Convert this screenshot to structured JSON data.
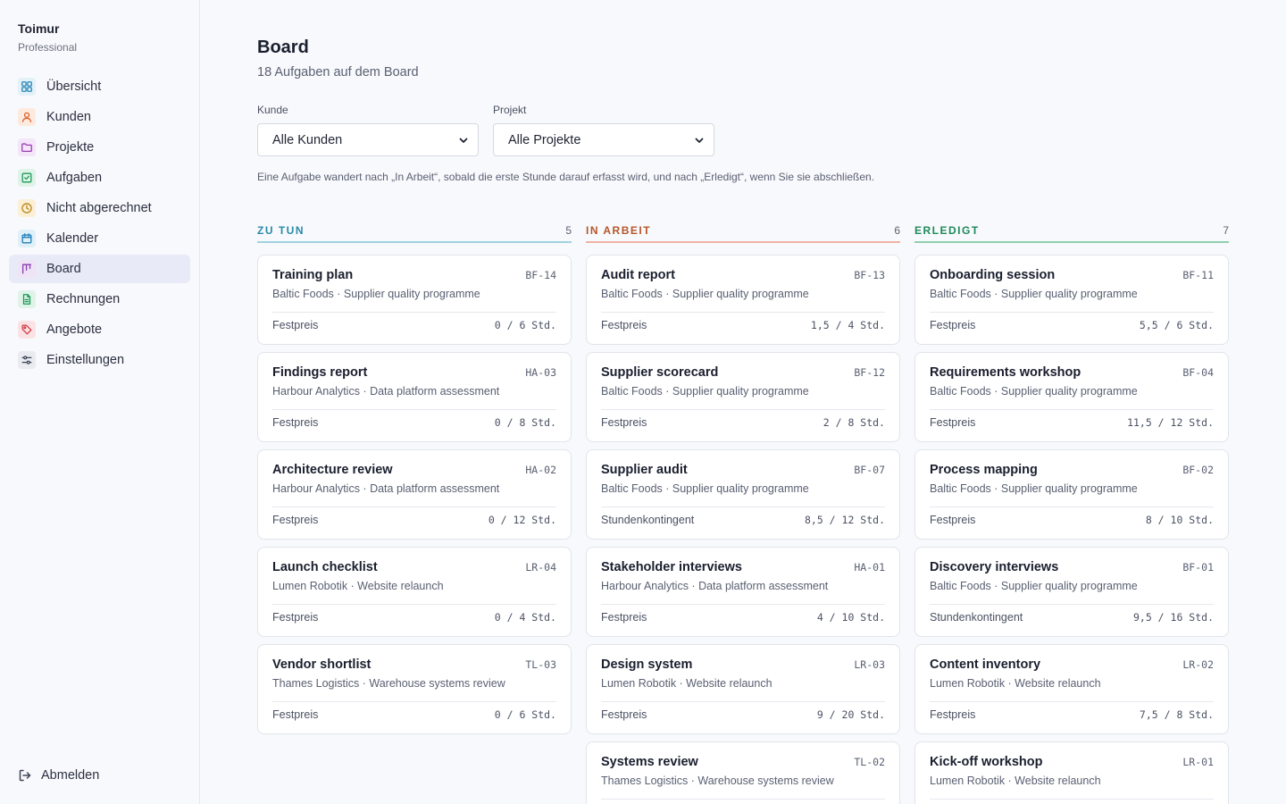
{
  "sidebar": {
    "brand_name": "Toimur",
    "brand_plan": "Professional",
    "items": [
      {
        "label": "Übersicht",
        "icon": "grid-icon",
        "color": "#2a86b8",
        "bg": "#e3f1f8"
      },
      {
        "label": "Kunden",
        "icon": "user-icon",
        "color": "#d9622b",
        "bg": "#fdeadf"
      },
      {
        "label": "Projekte",
        "icon": "folder-icon",
        "color": "#9b3fb5",
        "bg": "#f4e6f8"
      },
      {
        "label": "Aufgaben",
        "icon": "checkbox-icon",
        "color": "#1f9a5a",
        "bg": "#dff3e8"
      },
      {
        "label": "Nicht abgerechnet",
        "icon": "clock-icon",
        "color": "#b8861a",
        "bg": "#fbf0d6"
      },
      {
        "label": "Kalender",
        "icon": "calendar-icon",
        "color": "#1f7fb8",
        "bg": "#dff0f8"
      },
      {
        "label": "Board",
        "icon": "kanban-icon",
        "color": "#8a3fb0",
        "bg": "#efe3f6"
      },
      {
        "label": "Rechnungen",
        "icon": "document-icon",
        "color": "#1f9a5a",
        "bg": "#dff3e8"
      },
      {
        "label": "Angebote",
        "icon": "tag-icon",
        "color": "#d23f4a",
        "bg": "#fbe3e5"
      },
      {
        "label": "Einstellungen",
        "icon": "sliders-icon",
        "color": "#3d4457",
        "bg": "#e9ebf0"
      }
    ],
    "active_index": 6,
    "logout_label": "Abmelden"
  },
  "header": {
    "title": "Board",
    "subtitle": "18 Aufgaben auf dem Board"
  },
  "filters": {
    "client_label": "Kunde",
    "client_value": "Alle Kunden",
    "project_label": "Projekt",
    "project_value": "Alle Projekte"
  },
  "hint": "Eine Aufgabe wandert nach „In Arbeit“, sobald die erste Stunde darauf erfasst wird, und nach „Erledigt“, wenn Sie sie abschließen.",
  "columns": [
    {
      "title": "ZU TUN",
      "count": "5",
      "color": "#2a8aa8",
      "line": "#9fd3df",
      "cards": [
        {
          "title": "Training plan",
          "code": "BF-14",
          "client": "Baltic Foods · Supplier quality programme",
          "billing": "Festpreis",
          "hours": "0 / 6 Std."
        },
        {
          "title": "Findings report",
          "code": "HA-03",
          "client": "Harbour Analytics · Data platform assessment",
          "billing": "Festpreis",
          "hours": "0 / 8 Std."
        },
        {
          "title": "Architecture review",
          "code": "HA-02",
          "client": "Harbour Analytics · Data platform assessment",
          "billing": "Festpreis",
          "hours": "0 / 12 Std."
        },
        {
          "title": "Launch checklist",
          "code": "LR-04",
          "client": "Lumen Robotik · Website relaunch",
          "billing": "Festpreis",
          "hours": "0 / 4 Std."
        },
        {
          "title": "Vendor shortlist",
          "code": "TL-03",
          "client": "Thames Logistics · Warehouse systems review",
          "billing": "Festpreis",
          "hours": "0 / 6 Std."
        }
      ]
    },
    {
      "title": "IN ARBEIT",
      "count": "6",
      "color": "#b5562a",
      "line": "#f0b2a4",
      "cards": [
        {
          "title": "Audit report",
          "code": "BF-13",
          "client": "Baltic Foods · Supplier quality programme",
          "billing": "Festpreis",
          "hours": "1,5 / 4 Std."
        },
        {
          "title": "Supplier scorecard",
          "code": "BF-12",
          "client": "Baltic Foods · Supplier quality programme",
          "billing": "Festpreis",
          "hours": "2 / 8 Std."
        },
        {
          "title": "Supplier audit",
          "code": "BF-07",
          "client": "Baltic Foods · Supplier quality programme",
          "billing": "Stundenkontingent",
          "hours": "8,5 / 12 Std."
        },
        {
          "title": "Stakeholder interviews",
          "code": "HA-01",
          "client": "Harbour Analytics · Data platform assessment",
          "billing": "Festpreis",
          "hours": "4 / 10 Std."
        },
        {
          "title": "Design system",
          "code": "LR-03",
          "client": "Lumen Robotik · Website relaunch",
          "billing": "Festpreis",
          "hours": "9 / 20 Std."
        },
        {
          "title": "Systems review",
          "code": "TL-02",
          "client": "Thames Logistics · Warehouse systems review",
          "billing": "",
          "hours": ""
        }
      ]
    },
    {
      "title": "ERLEDIGT",
      "count": "7",
      "color": "#1f8a5a",
      "line": "#8fcfae",
      "cards": [
        {
          "title": "Onboarding session",
          "code": "BF-11",
          "client": "Baltic Foods · Supplier quality programme",
          "billing": "Festpreis",
          "hours": "5,5 / 6 Std."
        },
        {
          "title": "Requirements workshop",
          "code": "BF-04",
          "client": "Baltic Foods · Supplier quality programme",
          "billing": "Festpreis",
          "hours": "11,5 / 12 Std."
        },
        {
          "title": "Process mapping",
          "code": "BF-02",
          "client": "Baltic Foods · Supplier quality programme",
          "billing": "Festpreis",
          "hours": "8 / 10 Std."
        },
        {
          "title": "Discovery interviews",
          "code": "BF-01",
          "client": "Baltic Foods · Supplier quality programme",
          "billing": "Stundenkontingent",
          "hours": "9,5 / 16 Std."
        },
        {
          "title": "Content inventory",
          "code": "LR-02",
          "client": "Lumen Robotik · Website relaunch",
          "billing": "Festpreis",
          "hours": "7,5 / 8 Std."
        },
        {
          "title": "Kick-off workshop",
          "code": "LR-01",
          "client": "Lumen Robotik · Website relaunch",
          "billing": "",
          "hours": ""
        }
      ]
    }
  ]
}
